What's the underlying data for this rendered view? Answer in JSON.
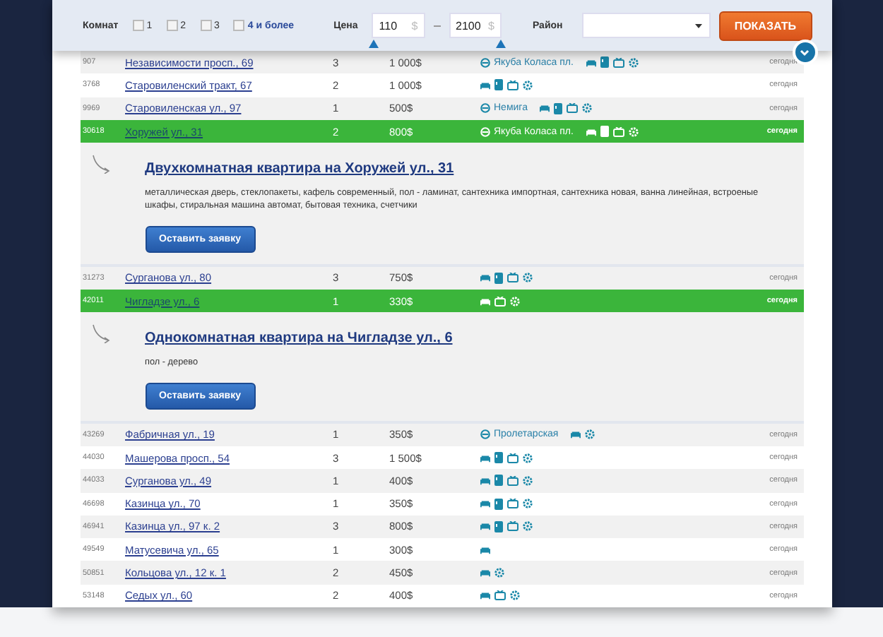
{
  "filter": {
    "rooms_label": "Комнат",
    "rooms": [
      {
        "label": "1",
        "checked": false
      },
      {
        "label": "2",
        "checked": false
      },
      {
        "label": "3",
        "checked": false
      },
      {
        "label": "4 и более",
        "checked": false
      }
    ],
    "price_label": "Цена",
    "price_from": "110",
    "price_to": "2100",
    "currency": "$",
    "district_label": "Район",
    "submit": "ПОКАЗАТЬ"
  },
  "listings": [
    {
      "kind": "row",
      "id": "907",
      "address": "Независимости просп., 69",
      "rooms": "3",
      "price": "1 000$",
      "metro": "Якуба Коласа пл.",
      "features": [
        {
          "kind": "furniture"
        },
        {
          "kind": "fridge"
        },
        {
          "kind": "tv"
        },
        {
          "kind": "washer"
        }
      ],
      "date": "сегодня",
      "selected": false
    },
    {
      "kind": "row",
      "id": "3768",
      "address": "Старовиленский тракт, 67",
      "rooms": "2",
      "price": "1 000$",
      "features": [
        {
          "kind": "furniture"
        },
        {
          "kind": "fridge"
        },
        {
          "kind": "tv"
        },
        {
          "kind": "washer"
        }
      ],
      "date": "сегодня",
      "selected": false
    },
    {
      "kind": "row",
      "id": "9969",
      "address": "Старовиленская ул., 97",
      "rooms": "1",
      "price": "500$",
      "metro": "Немига",
      "features": [
        {
          "kind": "furniture"
        },
        {
          "kind": "fridge"
        },
        {
          "kind": "tv"
        },
        {
          "kind": "washer"
        }
      ],
      "date": "сегодня",
      "selected": false
    },
    {
      "kind": "row",
      "id": "30618",
      "address": "Хоружей ул., 31",
      "rooms": "2",
      "price": "800$",
      "metro": "Якуба Коласа пл.",
      "features": [
        {
          "kind": "furniture"
        },
        {
          "kind": "fridge"
        },
        {
          "kind": "tv"
        },
        {
          "kind": "washer"
        }
      ],
      "date": "сегодня",
      "selected": true
    },
    {
      "kind": "detail",
      "title": "Двухкомнатная квартира на Хоружей ул., 31",
      "description": "металлическая дверь, стеклопакеты, кафель современный, пол - ламинат, сантехника импортная, сантехника новая, ванна линейная, встроеные шкафы, стиральная машина автомат, бытовая техника, счетчики",
      "button": "Оставить заявку"
    },
    {
      "kind": "row",
      "id": "31273",
      "address": "Сурганова ул., 80",
      "rooms": "3",
      "price": "750$",
      "features": [
        {
          "kind": "furniture"
        },
        {
          "kind": "fridge"
        },
        {
          "kind": "tv"
        },
        {
          "kind": "washer"
        }
      ],
      "date": "сегодня",
      "selected": false
    },
    {
      "kind": "row",
      "id": "42011",
      "address": "Чигладзе ул., 6",
      "rooms": "1",
      "price": "330$",
      "features": [
        {
          "kind": "furniture"
        },
        {
          "kind": "tv"
        },
        {
          "kind": "washer"
        }
      ],
      "date": "сегодня",
      "selected": true
    },
    {
      "kind": "detail",
      "title": "Однокомнатная квартира на Чигладзе ул., 6",
      "description": "пол - дерево",
      "button": "Оставить заявку"
    },
    {
      "kind": "row",
      "id": "43269",
      "address": "Фабричная ул., 19",
      "rooms": "1",
      "price": "350$",
      "metro": "Пролетарская",
      "features": [
        {
          "kind": "furniture"
        },
        {
          "kind": "washer"
        }
      ],
      "date": "сегодня",
      "selected": false
    },
    {
      "kind": "row",
      "id": "44030",
      "address": "Машерова просп., 54",
      "rooms": "3",
      "price": "1 500$",
      "features": [
        {
          "kind": "furniture"
        },
        {
          "kind": "fridge"
        },
        {
          "kind": "tv"
        },
        {
          "kind": "washer"
        }
      ],
      "date": "сегодня",
      "selected": false
    },
    {
      "kind": "row",
      "id": "44033",
      "address": "Сурганова ул., 49",
      "rooms": "1",
      "price": "400$",
      "features": [
        {
          "kind": "furniture"
        },
        {
          "kind": "fridge"
        },
        {
          "kind": "tv"
        },
        {
          "kind": "washer"
        }
      ],
      "date": "сегодня",
      "selected": false
    },
    {
      "kind": "row",
      "id": "46698",
      "address": "Казинца ул., 70",
      "rooms": "1",
      "price": "350$",
      "features": [
        {
          "kind": "furniture"
        },
        {
          "kind": "fridge"
        },
        {
          "kind": "tv"
        },
        {
          "kind": "washer"
        }
      ],
      "date": "сегодня",
      "selected": false
    },
    {
      "kind": "row",
      "id": "46941",
      "address": "Казинца ул., 97 к. 2",
      "rooms": "3",
      "price": "800$",
      "features": [
        {
          "kind": "furniture"
        },
        {
          "kind": "fridge"
        },
        {
          "kind": "tv"
        },
        {
          "kind": "washer"
        }
      ],
      "date": "сегодня",
      "selected": false
    },
    {
      "kind": "row",
      "id": "49549",
      "address": "Матусевича ул., 65",
      "rooms": "1",
      "price": "300$",
      "features": [
        {
          "kind": "furniture"
        }
      ],
      "date": "сегодня",
      "selected": false
    },
    {
      "kind": "row",
      "id": "50851",
      "address": "Кольцова ул., 12 к. 1",
      "rooms": "2",
      "price": "450$",
      "features": [
        {
          "kind": "furniture"
        },
        {
          "kind": "washer"
        }
      ],
      "date": "сегодня",
      "selected": false
    },
    {
      "kind": "row",
      "id": "53148",
      "address": "Седых ул., 60",
      "rooms": "2",
      "price": "400$",
      "features": [
        {
          "kind": "furniture"
        },
        {
          "kind": "tv"
        },
        {
          "kind": "washer"
        }
      ],
      "date": "сегодня",
      "selected": false
    }
  ]
}
